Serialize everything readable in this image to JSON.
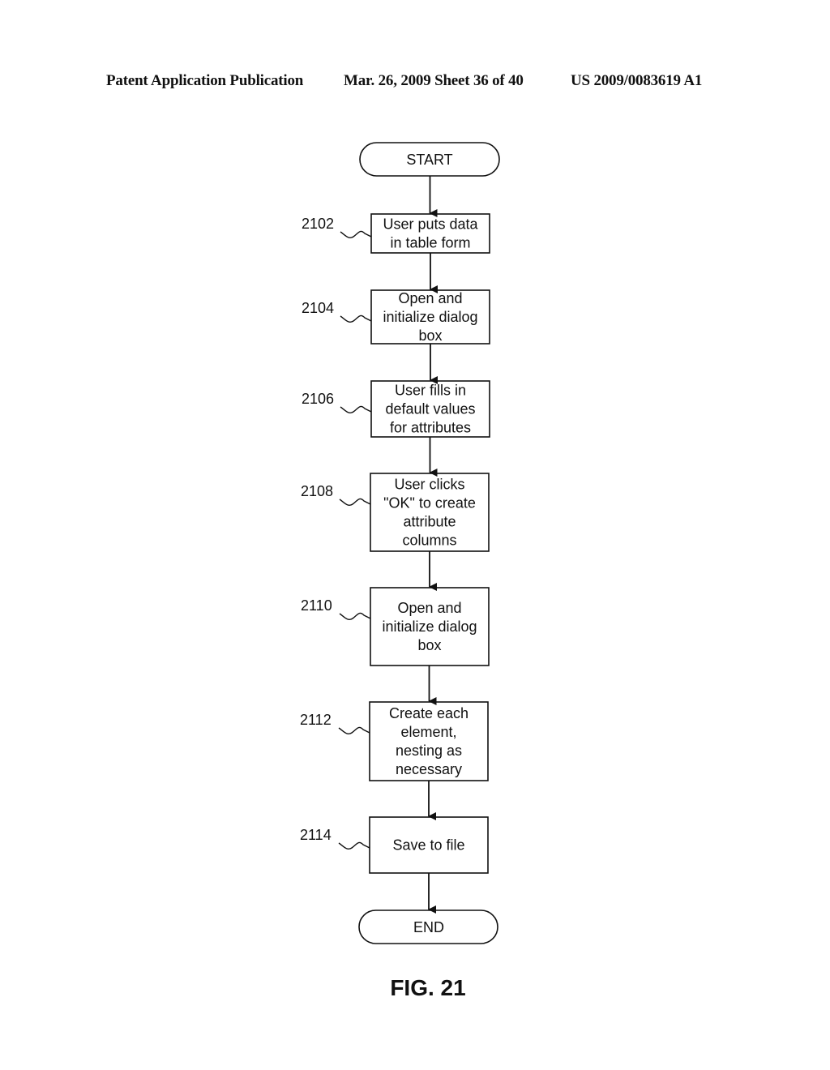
{
  "header": {
    "left": "Patent Application Publication",
    "middle": "Mar. 26, 2009  Sheet 36 of 40",
    "right": "US 2009/0083619 A1"
  },
  "flowchart": {
    "start": "START",
    "end": "END",
    "steps": [
      {
        "ref": "2102",
        "lines": [
          "User puts data",
          "in table form"
        ]
      },
      {
        "ref": "2104",
        "lines": [
          "Open and",
          "initialize dialog",
          "box"
        ]
      },
      {
        "ref": "2106",
        "lines": [
          "User fills in",
          "default values",
          "for attributes"
        ]
      },
      {
        "ref": "2108",
        "lines": [
          "User clicks",
          "\"OK\" to create",
          "attribute",
          "columns"
        ]
      },
      {
        "ref": "2110",
        "lines": [
          "Open and",
          "initialize dialog",
          "box"
        ]
      },
      {
        "ref": "2112",
        "lines": [
          "Create each",
          "element,",
          "nesting as",
          "necessary"
        ]
      },
      {
        "ref": "2114",
        "lines": [
          "Save to file"
        ]
      }
    ]
  },
  "figure_label": "FIG. 21"
}
